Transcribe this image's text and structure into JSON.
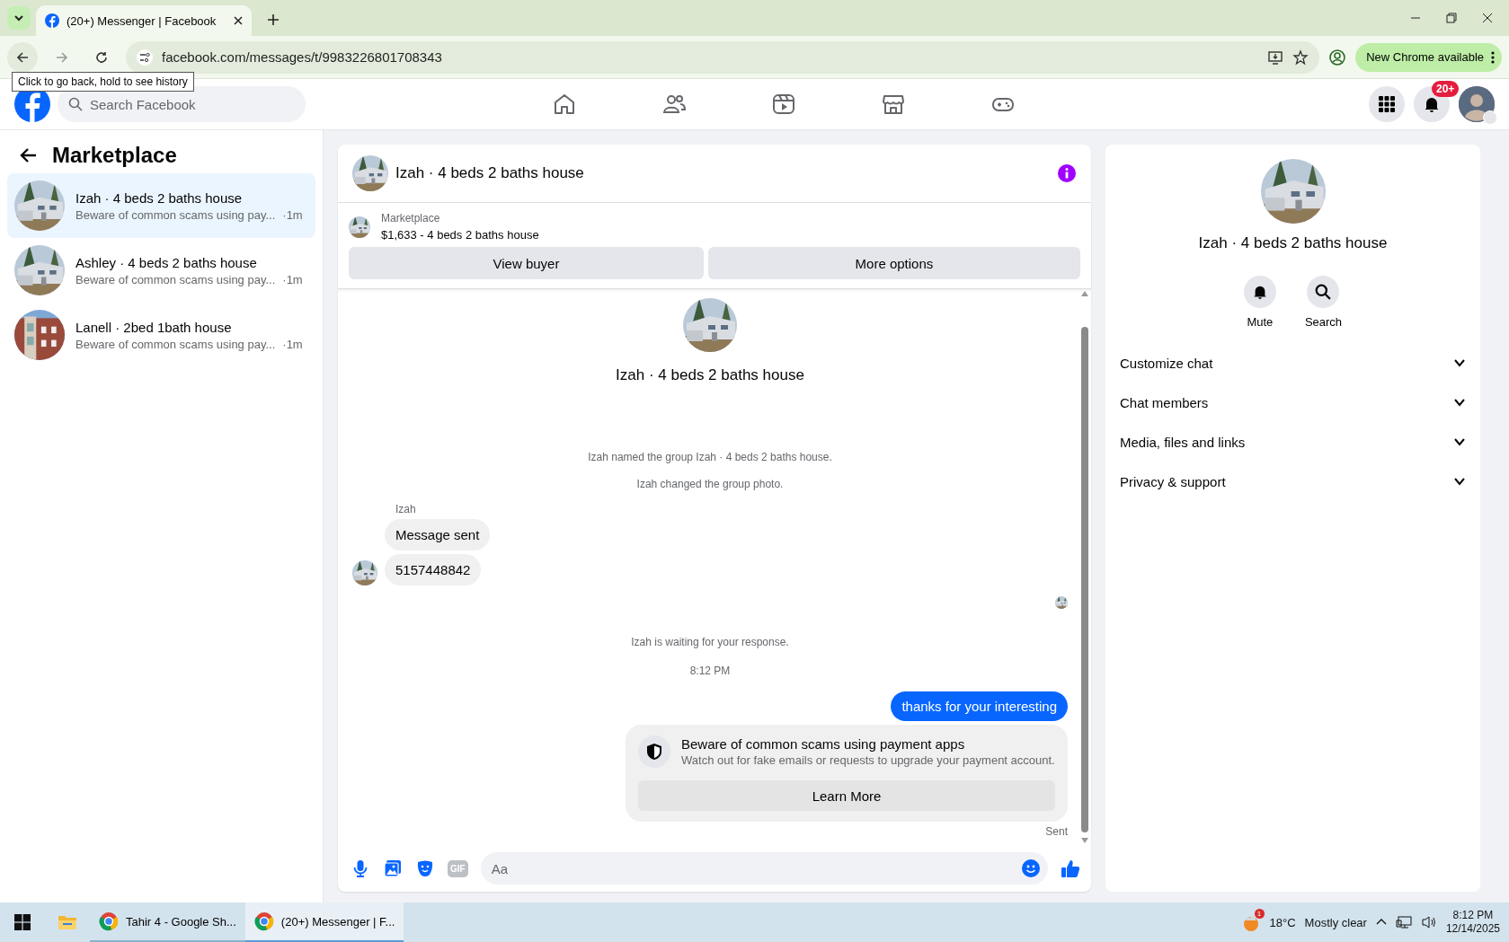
{
  "browser": {
    "tabs": [
      {
        "title": "(20+) Messenger | Facebook",
        "selected": true
      }
    ],
    "url": "facebook.com/messages/t/9983226801708343",
    "update_button": "New Chrome available",
    "tooltip": "Click to go back, hold to see history"
  },
  "header": {
    "search_placeholder": "Search Facebook",
    "notification_badge": "20+"
  },
  "sidebar": {
    "title": "Marketplace",
    "conversations": [
      {
        "name": "Izah · 4 beds 2 baths house",
        "preview": "Beware of common scams using pay...",
        "time": "·1m",
        "selected": true
      },
      {
        "name": "Ashley · 4 beds 2 baths house",
        "preview": "Beware of common scams using pay...",
        "time": "·1m",
        "selected": false
      },
      {
        "name": "Lanell · 2bed 1bath house",
        "preview": "Beware of common scams using pay...",
        "time": "·1m",
        "selected": false
      }
    ]
  },
  "chat": {
    "title": "Izah · 4 beds 2 baths house",
    "listing": {
      "source": "Marketplace",
      "title": "$1,633 - 4 beds 2 baths house",
      "buttons": [
        "View buyer",
        "More options"
      ]
    },
    "intro_title": "Izah · 4 beds 2 baths house",
    "messages": [
      {
        "kind": "system",
        "text": "Izah named the group Izah · 4 beds 2 baths house."
      },
      {
        "kind": "system",
        "text": "Izah changed the group photo."
      },
      {
        "kind": "sender",
        "text": "Izah"
      },
      {
        "kind": "incoming",
        "text": "Message sent",
        "avatar": false
      },
      {
        "kind": "incoming",
        "text": "5157448842",
        "avatar": true
      },
      {
        "kind": "read_receipt"
      },
      {
        "kind": "system",
        "text": "Izah is waiting for your response."
      },
      {
        "kind": "timestamp",
        "text": "8:12 PM"
      },
      {
        "kind": "outgoing",
        "text": "thanks for your interesting"
      },
      {
        "kind": "notice",
        "title": "Beware of common scams using payment apps",
        "body": "Watch out for fake emails or requests to upgrade your payment account.",
        "button": "Learn More"
      },
      {
        "kind": "status",
        "text": "Sent"
      }
    ],
    "composer": {
      "placeholder": "Aa",
      "gif_label": "GIF"
    }
  },
  "details": {
    "title": "Izah · 4 beds 2 baths house",
    "actions": [
      "Mute",
      "Search"
    ],
    "sections": [
      {
        "label": "Customize chat",
        "expanded": false
      },
      {
        "label": "Chat members",
        "expanded": false
      },
      {
        "label": "Media, files and links",
        "expanded": false
      },
      {
        "label": "Privacy & support",
        "expanded": false
      }
    ]
  },
  "taskbar": {
    "apps": [
      {
        "label": "Tahir 4 - Google Sh...",
        "selected": false
      },
      {
        "label": "(20+) Messenger | F...",
        "selected": true
      }
    ],
    "weather_badge": "1",
    "temperature": "18°C",
    "weather": "Mostly clear",
    "time": "8:12 PM",
    "date": "12/14/2025"
  }
}
